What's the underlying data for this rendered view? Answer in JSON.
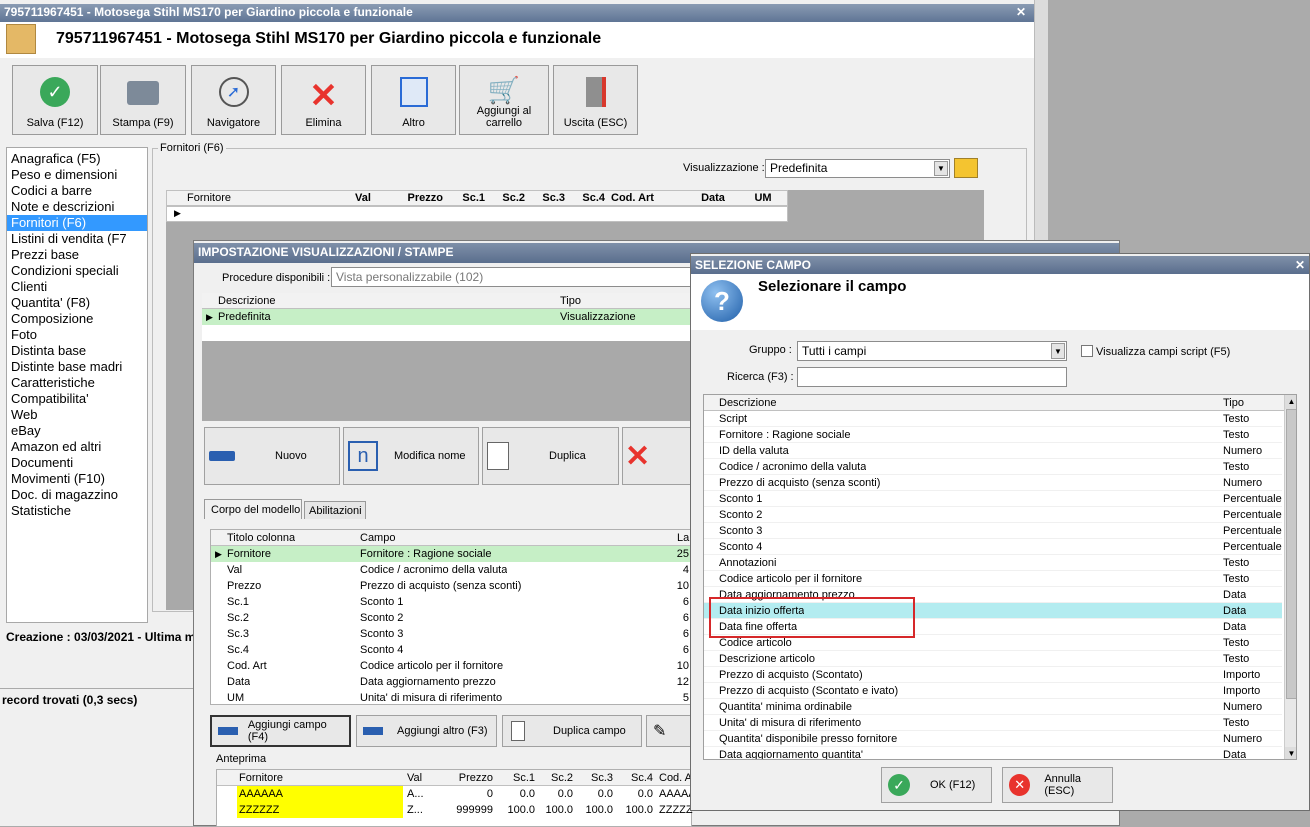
{
  "main_window": {
    "titlebar": "795711967451 - Motosega Stihl MS170 per Giardino piccola e funzionale",
    "heading": "795711967451 - Motosega Stihl MS170 per Giardino piccola e funzionale",
    "toolbar": {
      "save": "Salva (F12)",
      "print": "Stampa (F9)",
      "navigator": "Navigatore",
      "delete": "Elimina",
      "other": "Altro",
      "cart_line1": "Aggiungi al",
      "cart_line2": "carrello",
      "exit": "Uscita (ESC)"
    },
    "sidebar": [
      "Anagrafica (F5)",
      "Peso e dimensioni",
      "Codici a barre",
      "Note e descrizioni",
      "Fornitori (F6)",
      "Listini di vendita (F7",
      "Prezzi base",
      "Condizioni speciali",
      "Clienti",
      "Quantita' (F8)",
      "Composizione",
      "Foto",
      "Distinta base",
      "Distinte base madri",
      "Caratteristiche",
      "Compatibilita'",
      "Web",
      "eBay",
      "Amazon ed altri",
      "Documenti",
      "Movimenti (F10)",
      "Doc. di magazzino",
      "Statistiche"
    ],
    "group_label": "Fornitori (F6)",
    "view_label": "Visualizzazione :",
    "view_value": "Predefinita",
    "grid_headers": [
      "Fornitore",
      "Val",
      "Prezzo",
      "Sc.1",
      "Sc.2",
      "Sc.3",
      "Sc.4",
      "Cod. Art",
      "Data",
      "UM"
    ],
    "footer_created": "Creazione : 03/03/2021 - Ultima m",
    "status": "record trovati (0,3 secs)"
  },
  "impostazione": {
    "title": "IMPOSTAZIONE VISUALIZZAZIONI / STAMPE",
    "procedure_label": "Procedure disponibili :",
    "procedure_value": "Vista personalizzabile (102)",
    "grid_headers": [
      "Descrizione",
      "Tipo"
    ],
    "rows": [
      [
        "Predefinita",
        "Visualizzazione"
      ]
    ],
    "buttons": {
      "new": "Nuovo",
      "rename": "Modifica nome",
      "duplicate": "Duplica"
    },
    "tabs": [
      "Corpo del modello",
      "Abilitazioni"
    ],
    "body_headers": [
      "Titolo colonna",
      "Campo",
      "Lar"
    ],
    "body_rows": [
      [
        "Fornitore",
        "Fornitore : Ragione sociale",
        "25"
      ],
      [
        "Val",
        "Codice / acronimo della valuta",
        "4"
      ],
      [
        "Prezzo",
        "Prezzo di acquisto (senza sconti)",
        "10"
      ],
      [
        "Sc.1",
        "Sconto 1",
        "6"
      ],
      [
        "Sc.2",
        "Sconto 2",
        "6"
      ],
      [
        "Sc.3",
        "Sconto 3",
        "6"
      ],
      [
        "Sc.4",
        "Sconto 4",
        "6"
      ],
      [
        "Cod. Art",
        "Codice articolo per il fornitore",
        "10"
      ],
      [
        "Data",
        "Data aggiornamento prezzo",
        "12"
      ],
      [
        "UM",
        "Unita' di misura di riferimento",
        "5"
      ]
    ],
    "bottom_buttons": {
      "add_field": "Aggiungi campo (F4)",
      "add_other": "Aggiungi altro (F3)",
      "dup_field": "Duplica campo"
    },
    "preview_label": "Anteprima",
    "preview_headers": [
      "Fornitore",
      "Val",
      "Prezzo",
      "Sc.1",
      "Sc.2",
      "Sc.3",
      "Sc.4",
      "Cod. A"
    ],
    "preview_rows": [
      [
        "AAAAAA",
        "A...",
        "0",
        "0.0",
        "0.0",
        "0.0",
        "0.0",
        "AAAAA"
      ],
      [
        "ZZZZZZ",
        "Z...",
        "999999",
        "100.0",
        "100.0",
        "100.0",
        "100.0",
        "ZZZZZ"
      ]
    ]
  },
  "selezione": {
    "title": "SELEZIONE CAMPO",
    "heading": "Selezionare il campo",
    "group_label": "Gruppo :",
    "group_value": "Tutti i campi",
    "script_checkbox": "Visualizza campi script (F5)",
    "search_label": "Ricerca (F3) :",
    "search_value": "",
    "headers": [
      "Descrizione",
      "Tipo"
    ],
    "rows": [
      [
        "Script",
        "Testo"
      ],
      [
        "Fornitore : Ragione sociale",
        "Testo"
      ],
      [
        "ID della valuta",
        "Numero"
      ],
      [
        "Codice / acronimo della valuta",
        "Testo"
      ],
      [
        "Prezzo di acquisto (senza sconti)",
        "Numero"
      ],
      [
        "Sconto 1",
        "Percentuale"
      ],
      [
        "Sconto 2",
        "Percentuale"
      ],
      [
        "Sconto 3",
        "Percentuale"
      ],
      [
        "Sconto 4",
        "Percentuale"
      ],
      [
        "Annotazioni",
        "Testo"
      ],
      [
        "Codice articolo per il fornitore",
        "Testo"
      ],
      [
        "Data aggiornamento prezzo",
        "Data"
      ],
      [
        "Data inizio offerta",
        "Data"
      ],
      [
        "Data fine offerta",
        "Data"
      ],
      [
        "Codice articolo",
        "Testo"
      ],
      [
        "Descrizione articolo",
        "Testo"
      ],
      [
        "Prezzo di acquisto (Scontato)",
        "Importo"
      ],
      [
        "Prezzo di acquisto (Scontato e ivato)",
        "Importo"
      ],
      [
        "Quantita' minima ordinabile",
        "Numero"
      ],
      [
        "Unita' di misura di riferimento",
        "Testo"
      ],
      [
        "Quantita' disponibile presso fornitore",
        "Numero"
      ],
      [
        "Data aggiornamento quantita'",
        "Data"
      ]
    ],
    "ok": "OK (F12)",
    "cancel": "Annulla (ESC)"
  }
}
